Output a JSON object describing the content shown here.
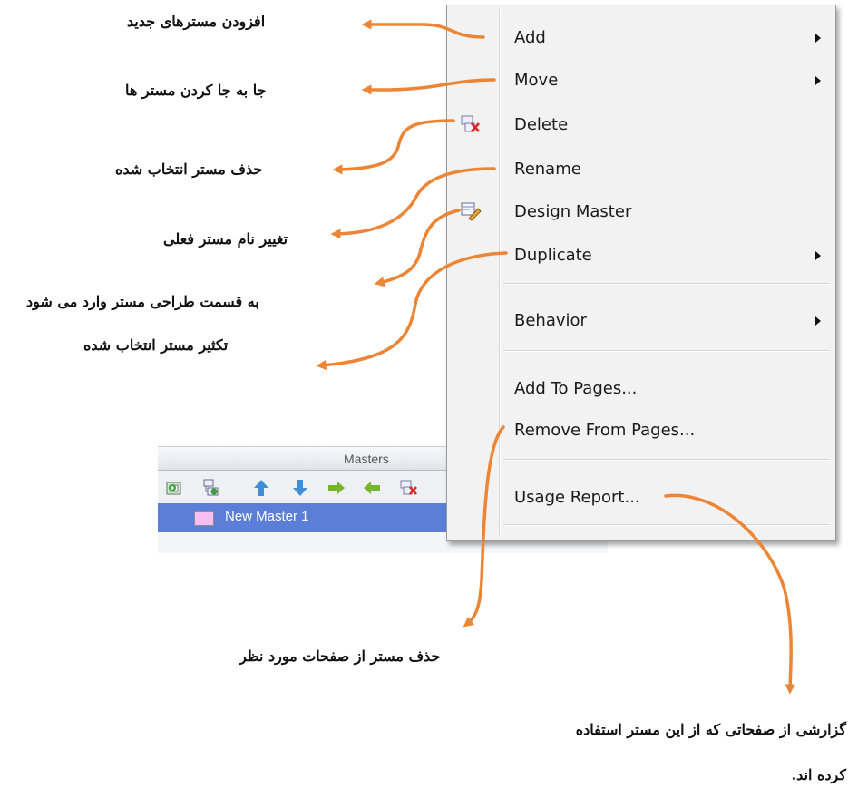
{
  "colors": {
    "accent_arrow": "#ec8535",
    "selection": "#5b7fd9",
    "menu_bg": "#f2f2f2"
  },
  "masters_panel": {
    "title": "Masters",
    "toolbar_icons": [
      "add-master-icon",
      "add-child-master-icon",
      "move-up-icon",
      "move-down-icon",
      "indent-right-icon",
      "outdent-left-icon",
      "delete-master-icon"
    ],
    "items": [
      {
        "label": "New Master 1",
        "selected": true
      }
    ]
  },
  "context_menu": {
    "items": [
      {
        "label": "Add",
        "has_submenu": true,
        "icon": ""
      },
      {
        "label": "Move",
        "has_submenu": true,
        "icon": ""
      },
      {
        "label": "Delete",
        "has_submenu": false,
        "icon": "delete-master-icon"
      },
      {
        "label": "Rename",
        "has_submenu": false,
        "icon": ""
      },
      {
        "label": "Design Master",
        "has_submenu": false,
        "icon": "design-master-icon"
      },
      {
        "label": "Duplicate",
        "has_submenu": true,
        "icon": ""
      },
      {
        "label": "Behavior",
        "has_submenu": true,
        "icon": ""
      },
      {
        "label": "Add To Pages...",
        "has_submenu": false,
        "icon": ""
      },
      {
        "label": "Remove From Pages...",
        "has_submenu": false,
        "icon": ""
      },
      {
        "label": "Usage Report...",
        "has_submenu": false,
        "icon": ""
      }
    ]
  },
  "annotations": {
    "add": "افزودن مسترهای جدید",
    "move": "جا به جا کردن مستر ها",
    "delete": "حذف مستر انتخاب شده",
    "rename": "تغییر نام مستر فعلی",
    "design": "به قسمت طراحی مستر وارد می شود",
    "duplicate": "تکثیر مستر انتخاب شده",
    "remove_from_pages": "حذف مستر از صفحات مورد نظر",
    "usage_report_line1": "گزارشی از صفحاتی که از این مستر استفاده",
    "usage_report_line2": "کرده اند."
  }
}
